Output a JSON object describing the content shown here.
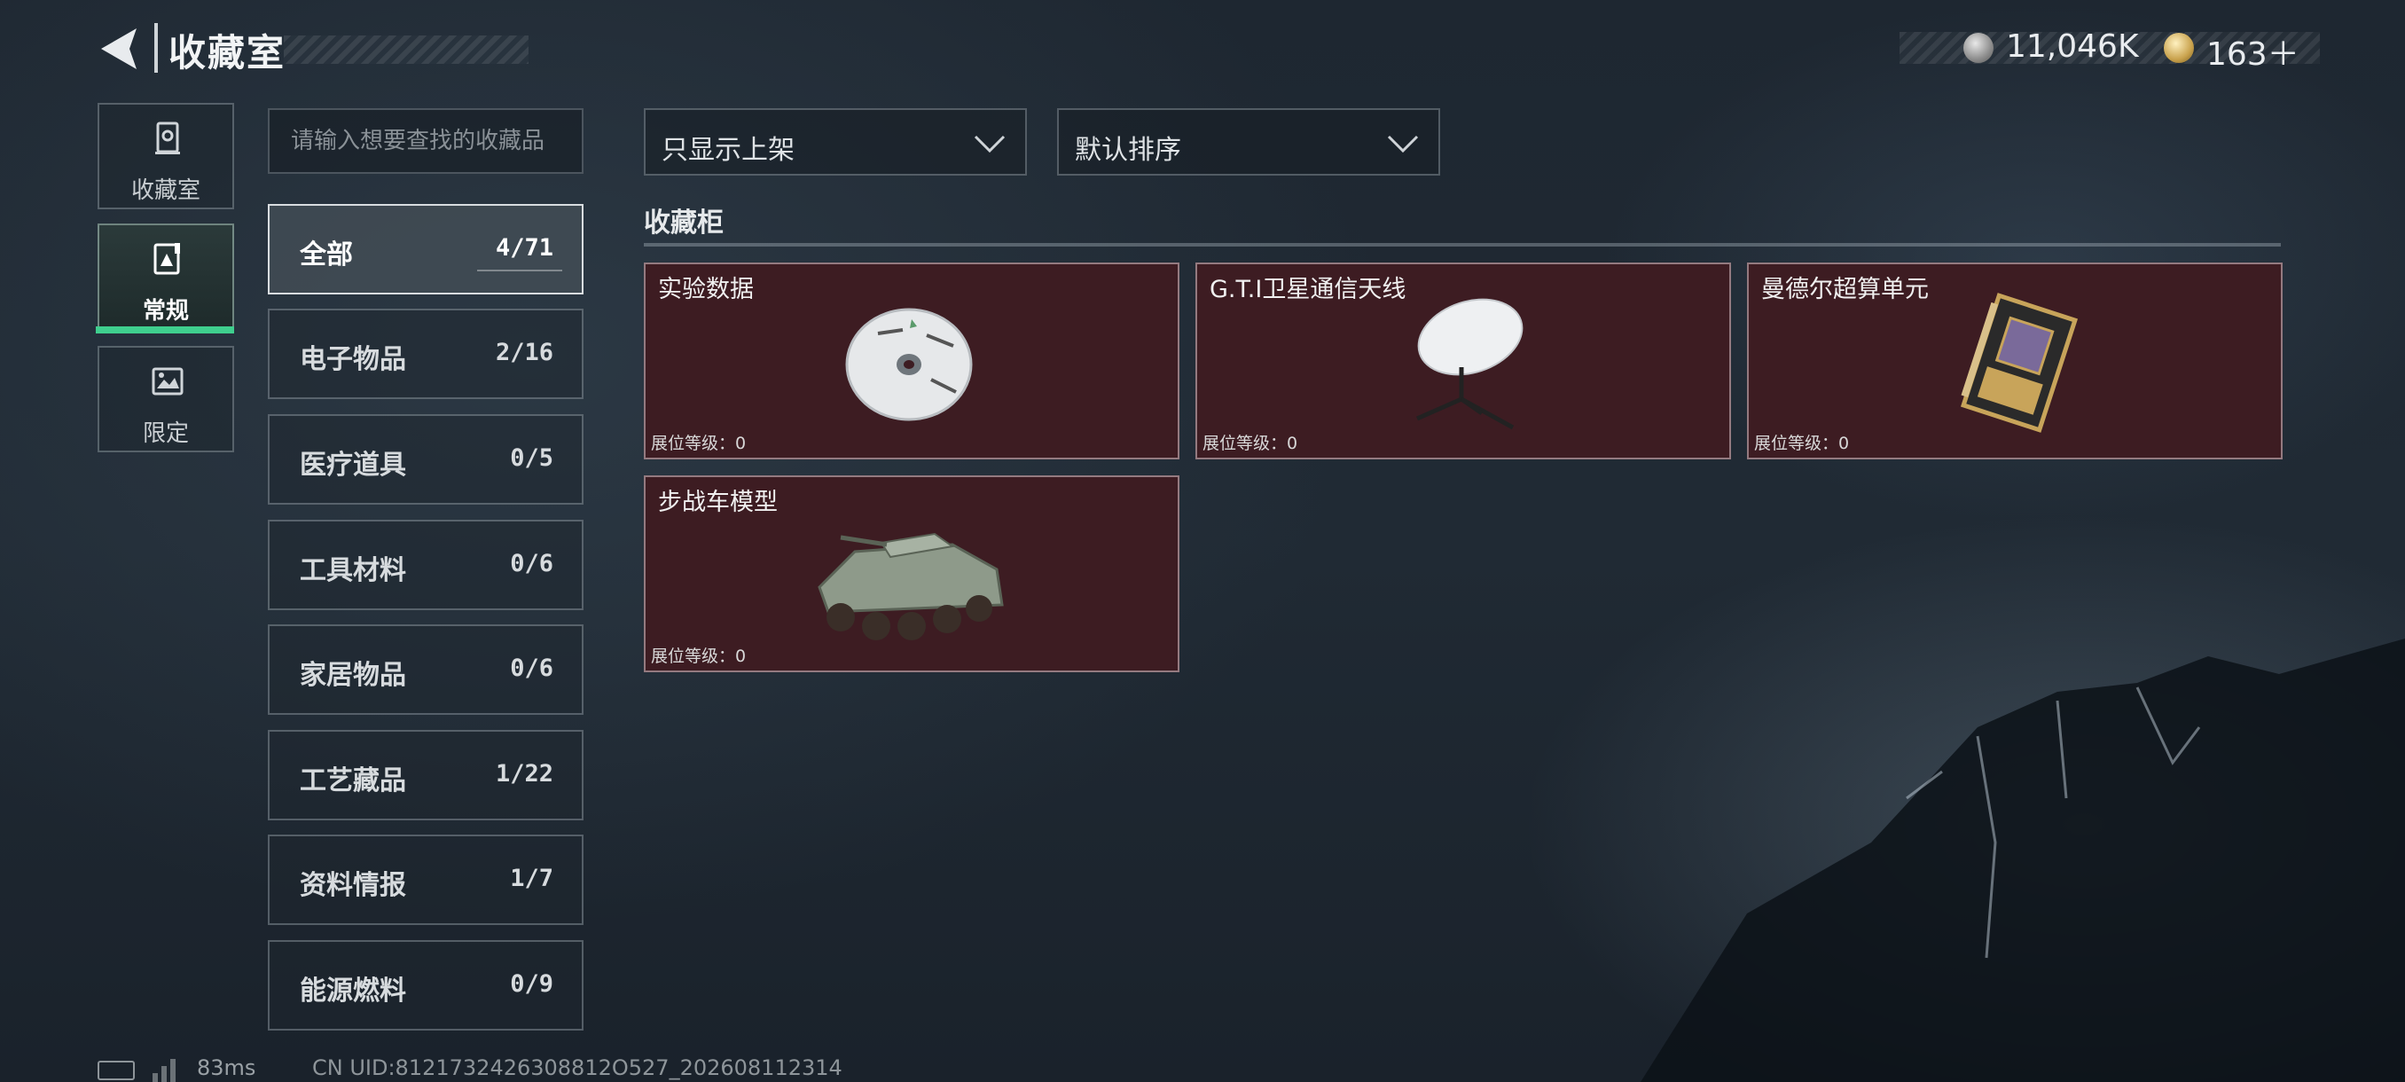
{
  "header": {
    "title": "收藏室",
    "currency": [
      {
        "icon": "silver-coin-icon",
        "value": "11,046K"
      },
      {
        "icon": "gold-coin-icon",
        "value": "163＋"
      }
    ]
  },
  "vertical_tabs": [
    {
      "label": "收藏室",
      "icon": "collection-room-icon",
      "active": false
    },
    {
      "label": "常规",
      "icon": "regular-card-icon",
      "active": true
    },
    {
      "label": "限定",
      "icon": "limited-image-icon",
      "active": false
    }
  ],
  "search": {
    "placeholder": "请输入想要查找的收藏品",
    "value": ""
  },
  "categories": [
    {
      "name": "全部",
      "count": "4/71",
      "active": true
    },
    {
      "name": "电子物品",
      "count": "2/16"
    },
    {
      "name": "医疗道具",
      "count": "0/5"
    },
    {
      "name": "工具材料",
      "count": "0/6"
    },
    {
      "name": "家居物品",
      "count": "0/6"
    },
    {
      "name": "工艺藏品",
      "count": "1/22"
    },
    {
      "name": "资料情报",
      "count": "1/7"
    },
    {
      "name": "能源燃料",
      "count": "0/9"
    }
  ],
  "filters": {
    "display": "只显示上架",
    "sort": "默认排序"
  },
  "cabinet": {
    "title": "收藏柜",
    "items": [
      {
        "name": "实验数据",
        "level": "展位等级：0",
        "icon": "data-disc-icon"
      },
      {
        "name": "G.T.I卫星通信天线",
        "level": "展位等级：0",
        "icon": "satellite-dish-icon"
      },
      {
        "name": "曼德尔超算单元",
        "level": "展位等级：0",
        "icon": "computing-unit-icon"
      },
      {
        "name": "步战车模型",
        "level": "展位等级：0",
        "icon": "ifv-model-icon"
      }
    ]
  },
  "footer": {
    "ping": "83ms",
    "uid": "CN UID:8121732426308812O527_202608112314"
  },
  "colors": {
    "accent": "#3fcf8e",
    "card_bg": "#3d1c22",
    "background": "#1e2731"
  }
}
